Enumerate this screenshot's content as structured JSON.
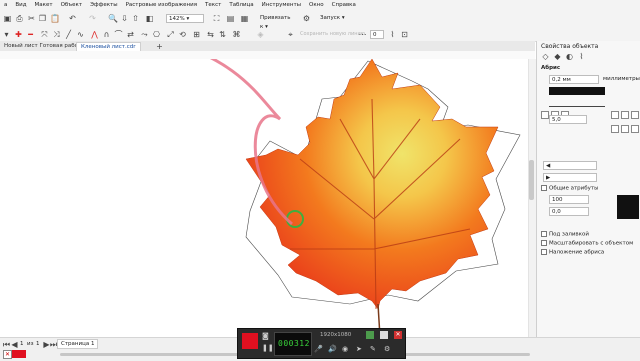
{
  "menu": [
    "а",
    "Вид",
    "Макет",
    "Объект",
    "Эффекты",
    "Растровые изображения",
    "Текст",
    "Таблица",
    "Инструменты",
    "Окно",
    "Справка"
  ],
  "toolbar": {
    "zoom": "142%",
    "snap": "Привязать к",
    "launch": "Запуск",
    "stepper_value": "0",
    "hint_label": "Сохранить новую линию"
  },
  "tabs": [
    "Новый лист Готовая работа.cdr",
    "Кленовый лист.cdr"
  ],
  "active_tab_index": 1,
  "properties": {
    "title": "Свойства объекта",
    "section": "Абрис",
    "width": "0,2 мм",
    "units": "миллиметры",
    "miter": "5,0",
    "scale": "100",
    "angle": "0,0",
    "common_attrs": "Общие атрибуты",
    "behind_fill": "Под заливкой",
    "scale_with_object": "Масштабировать с объектом",
    "overprint": "Наложение абриса"
  },
  "page_nav": {
    "current": "1",
    "of_label": "из",
    "total": "1",
    "page_tab": "Страница 1"
  },
  "recorder": {
    "timer": "000312",
    "resolution": "1920x1080"
  },
  "colors": {
    "leaf_red": "#e8331a",
    "leaf_orange": "#f37a1e",
    "leaf_yellow": "#f4d24a",
    "ribbon": "#e7748a",
    "record": "#e01020"
  }
}
